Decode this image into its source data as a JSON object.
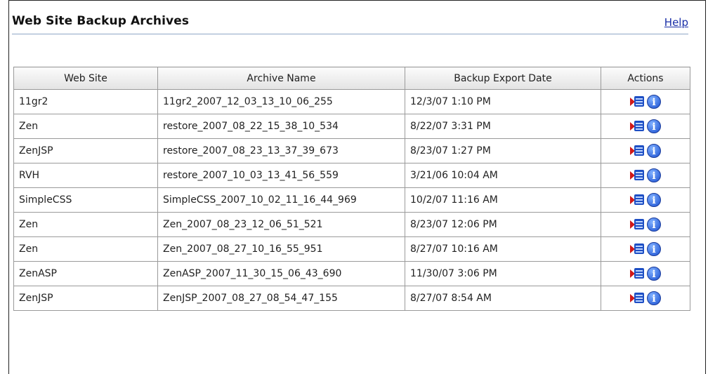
{
  "page": {
    "title": "Web Site Backup Archives",
    "help_label": "Help"
  },
  "table": {
    "columns": [
      "Web Site",
      "Archive Name",
      "Backup Export Date",
      "Actions"
    ],
    "rows": [
      {
        "site": "11gr2",
        "archive": "11gr2_2007_12_03_13_10_06_255",
        "date": "12/3/07 1:10 PM"
      },
      {
        "site": "Zen",
        "archive": "restore_2007_08_22_15_38_10_534",
        "date": "8/22/07 3:31 PM"
      },
      {
        "site": "ZenJSP",
        "archive": "restore_2007_08_23_13_37_39_673",
        "date": "8/23/07 1:27 PM"
      },
      {
        "site": "RVH",
        "archive": "restore_2007_10_03_13_41_56_559",
        "date": "3/21/06 10:04 AM"
      },
      {
        "site": "SimpleCSS",
        "archive": "SimpleCSS_2007_10_02_11_16_44_969",
        "date": "10/2/07 11:16 AM"
      },
      {
        "site": "Zen",
        "archive": "Zen_2007_08_23_12_06_51_521",
        "date": "8/23/07 12:06 PM"
      },
      {
        "site": "Zen",
        "archive": "Zen_2007_08_27_10_16_55_951",
        "date": "8/27/07 10:16 AM"
      },
      {
        "site": "ZenASP",
        "archive": "ZenASP_2007_11_30_15_06_43_690",
        "date": "11/30/07 3:06 PM"
      },
      {
        "site": "ZenJSP",
        "archive": "ZenJSP_2007_08_27_08_54_47_155",
        "date": "8/27/07 8:54 AM"
      }
    ],
    "actions": [
      "export-icon",
      "info-icon"
    ]
  },
  "colors": {
    "link": "#1a2fa8",
    "header_rule": "#8ea6c6",
    "grid": "#9a9a9a"
  }
}
